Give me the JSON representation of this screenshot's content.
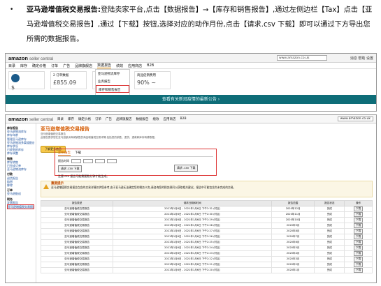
{
  "instruction": {
    "bullet": "•",
    "title": "亚马逊增值税交易报告:",
    "body": "登陆卖家平台,点击【数据报告】→【库存和销售报告】,通过左侧边栏【Tax】点击【亚马逊增值税交易报告】,通过【下载】按钮,选择对应的动作月份,点击【请求.csv 下载】即可以通过下方导出您所需的数据报告。"
  },
  "shot1": {
    "logo_main": "amazon",
    "logo_sub": "seller central",
    "search_text": "www.amazon.co.uk",
    "header_right": "消息  帮助  设置",
    "nav": [
      "目录",
      "库存",
      "确定价格",
      "订单",
      "广告",
      "品牌旗舰店",
      "数据报告",
      "绩效",
      "应用商店",
      "B2B"
    ],
    "active_nav": "数据报告",
    "cards": [
      {
        "label": "",
        "value": "$"
      },
      {
        "label": "2 订单数据",
        "value": "£855.09"
      },
      {
        "label": "",
        "value": ""
      },
      {
        "label": "商品促销费用",
        "value": "90% ~"
      }
    ],
    "menu": [
      "亚马逊物流库存",
      "业务报告",
      "库存和销售报告",
      "库存报告"
    ],
    "menu_highlight": "库存和销售报告",
    "banner": "查看有关新冠疫情的最新公告 ›"
  },
  "shot2": {
    "logo_main": "amazon",
    "logo_sub": "seller central",
    "top_nav": [
      "目录",
      "库存",
      "确定价格",
      "订单",
      "广告",
      "品牌旗舰店",
      "数据报告",
      "绩效",
      "应用商店",
      "B2B"
    ],
    "search_text": "www.amazon.co.uk",
    "sidebar": [
      {
        "t": "库存报告",
        "sec": true
      },
      {
        "t": "亚马逊物流库存",
        "sec": false
      },
      {
        "t": "库存年龄",
        "sec": false
      },
      {
        "t": "管理亚马逊库存",
        "sec": false
      },
      {
        "t": "亚马逊物流多渠道配送",
        "sec": false
      },
      {
        "t": "库存状况",
        "sec": false
      },
      {
        "t": "已收到的库存",
        "sec": false
      },
      {
        "t": "库存调整",
        "sec": false
      },
      {
        "t": "销售",
        "sec": true
      },
      {
        "t": "库存销售",
        "sec": false
      },
      {
        "t": "已完成订单",
        "sec": false
      },
      {
        "t": "亚马逊物流库存",
        "sec": false
      },
      {
        "t": "付款",
        "sec": true
      },
      {
        "t": "退货报告",
        "sec": false
      },
      {
        "t": "赔偿",
        "sec": false
      },
      {
        "t": "移除",
        "sec": false
      },
      {
        "t": "订单",
        "sec": true
      },
      {
        "t": "亚马逊配送",
        "sec": false
      },
      {
        "t": "税务",
        "sec": true
      },
      {
        "t": "发票报告",
        "sec": false
      },
      {
        "t": "亚马逊增值税交易报告",
        "sec": false,
        "sel": true
      }
    ],
    "title": "亚马逊增值税交易报告",
    "subtitle": "亚马逊增值税交易报告",
    "desc": "此报告提供您在亚马逊欧洲商城销售的商品增值税交易详情,包括您的销售、退货、退款和库存转移数据。",
    "learn_btn": "了解更多信息",
    "tabs": [
      "定制报告",
      "下载"
    ],
    "active_tab": "定制报告",
    "form_label": "报告时间",
    "csv_button": "请求 .csv 下载",
    "csv_button2": "请求 .csv 下载",
    "form_note": "注意:csv 报告可能需要数分钟才能生成。",
    "warn_title": "重要提示",
    "warn_text": "亚马逊增值税交易报告包含的交易详情仅供您参考,由于亚马逊无法确定您的税务义务,请咨询您的税务顾问以获取相关建议。报告中可能包含尚未完成的交易。",
    "table_headers": [
      "报告类型",
      "请求日期和时间",
      "报告范围",
      "报告状态",
      "操作"
    ],
    "rows": [
      [
        "亚马逊增值税交易报告",
        "2021年1月6日 - 2021年1月6日 下午2:31 (时区)",
        "2020年12月",
        "完成",
        "下载"
      ],
      [
        "亚马逊增值税交易报告",
        "2021年1月6日 - 2021年1月6日 下午2:30 (时区)",
        "2020年11月",
        "完成",
        "下载"
      ],
      [
        "亚马逊增值税交易报告",
        "2021年1月6日 - 2021年1月6日 下午2:29 (时区)",
        "2020年10月",
        "完成",
        "下载"
      ],
      [
        "亚马逊增值税交易报告",
        "2021年1月6日 - 2021年1月6日 下午2:28 (时区)",
        "2020年9月",
        "完成",
        "下载"
      ],
      [
        "亚马逊增值税交易报告",
        "2021年1月6日 - 2021年1月6日 下午2:27 (时区)",
        "2020年8月",
        "完成",
        "下载"
      ],
      [
        "亚马逊增值税交易报告",
        "2021年1月6日 - 2021年1月6日 下午2:26 (时区)",
        "2020年7月",
        "完成",
        "下载"
      ],
      [
        "亚马逊增值税交易报告",
        "2021年1月6日 - 2021年1月6日 下午2:25 (时区)",
        "2020年6月",
        "完成",
        "下载"
      ],
      [
        "亚马逊增值税交易报告",
        "2021年1月6日 - 2021年1月6日 下午2:24 (时区)",
        "2020年5月",
        "完成",
        "下载"
      ],
      [
        "亚马逊增值税交易报告",
        "2021年1月6日 - 2021年1月6日 下午2:23 (时区)",
        "2020年4月",
        "完成",
        "下载"
      ],
      [
        "亚马逊增值税交易报告",
        "2021年1月6日 - 2021年1月6日 下午2:22 (时区)",
        "2020年3月",
        "完成",
        "下载"
      ],
      [
        "亚马逊增值税交易报告",
        "2021年1月6日 - 2021年1月6日 下午2:21 (时区)",
        "2020年2月",
        "完成",
        "下载"
      ],
      [
        "亚马逊增值税交易报告",
        "2021年1月6日 - 2021年1月6日 下午2:20 (时区)",
        "2020年1月",
        "完成",
        "下载"
      ]
    ]
  },
  "colors": {
    "teal_banner": "#0e6d78",
    "amazon_orange": "#d55a00",
    "highlight_red": "#dd3333"
  }
}
